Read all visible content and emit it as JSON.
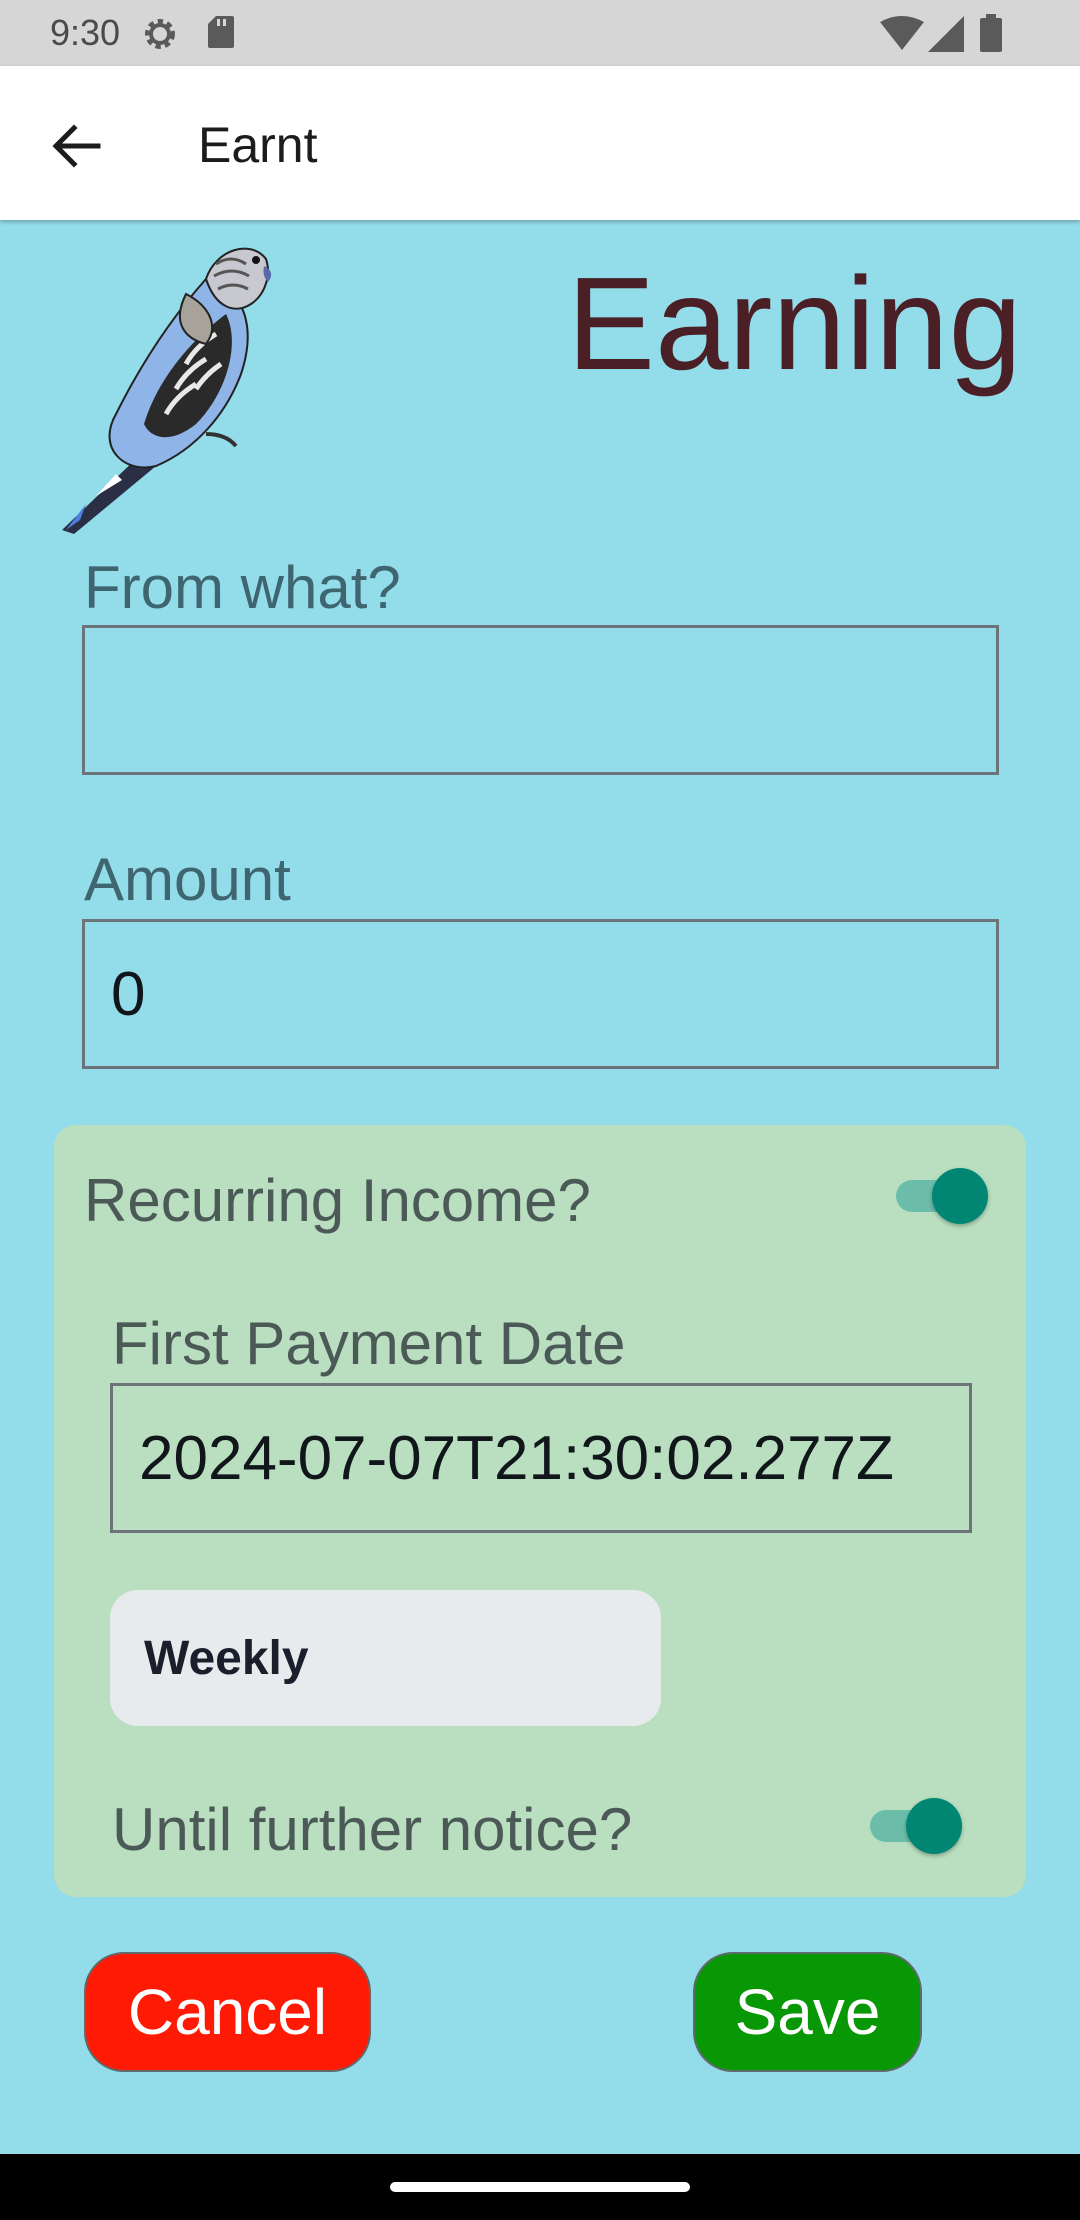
{
  "status_bar": {
    "time": "9:30"
  },
  "app_bar": {
    "title": "Earnt"
  },
  "heading": "Earning",
  "from_what": {
    "label": "From what?",
    "value": ""
  },
  "amount": {
    "label": "Amount",
    "value": "0"
  },
  "recurring": {
    "label": "Recurring Income?",
    "enabled": true,
    "first_payment": {
      "label": "First Payment Date",
      "value": "2024-07-07T21:30:02.277Z"
    },
    "frequency": {
      "selected": "Weekly"
    },
    "until_further_notice": {
      "label": "Until further notice?",
      "enabled": true
    }
  },
  "buttons": {
    "cancel": "Cancel",
    "save": "Save"
  },
  "colors": {
    "background": "#93dce9",
    "card": "#b9dfc0",
    "accent": "#008672",
    "heading": "#4a1f25",
    "cancel": "#ff1a05",
    "save": "#089806"
  },
  "icons": [
    "gear-icon",
    "sd-card-icon",
    "wifi-icon",
    "signal-icon",
    "battery-icon",
    "back-arrow-icon",
    "budgie-logo"
  ]
}
